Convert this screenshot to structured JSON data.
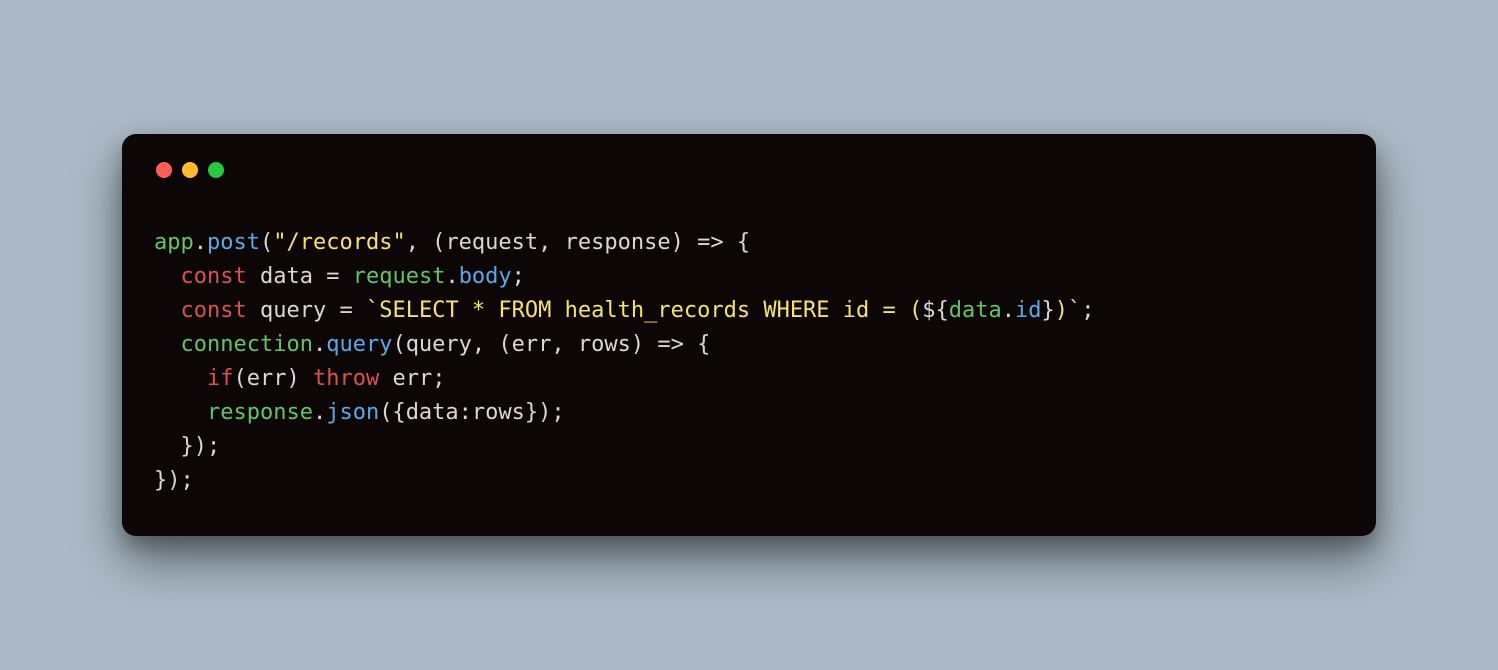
{
  "window": {
    "traffic_lights": [
      "red",
      "yellow",
      "green"
    ]
  },
  "code": {
    "line1": {
      "t1": "app",
      "t2": ".",
      "t3": "post",
      "t4": "(",
      "t5": "\"/records\"",
      "t6": ", (",
      "t7": "request",
      "t8": ", ",
      "t9": "response",
      "t10": ") ",
      "t11": "=>",
      "t12": " {"
    },
    "line2": {
      "indent": "  ",
      "t1": "const",
      "t2": " ",
      "t3": "data",
      "t4": " ",
      "t5": "=",
      "t6": " ",
      "t7": "request",
      "t8": ".",
      "t9": "body",
      "t10": ";"
    },
    "line3": {
      "indent": "  ",
      "t1": "const",
      "t2": " ",
      "t3": "query",
      "t4": " ",
      "t5": "=",
      "t6": " ",
      "t7": "`SELECT * FROM health_records WHERE id = (",
      "t8": "${",
      "t9": "data",
      "t10": ".",
      "t11": "id",
      "t12": "}",
      "t13": ")`",
      "t14": ";"
    },
    "line4": {
      "indent": "  ",
      "t1": "connection",
      "t2": ".",
      "t3": "query",
      "t4": "(",
      "t5": "query",
      "t6": ", (",
      "t7": "err",
      "t8": ", ",
      "t9": "rows",
      "t10": ") ",
      "t11": "=>",
      "t12": " {"
    },
    "line5": {
      "indent": "    ",
      "t1": "if",
      "t2": "(",
      "t3": "err",
      "t4": ") ",
      "t5": "throw",
      "t6": " ",
      "t7": "err",
      "t8": ";"
    },
    "line6": {
      "indent": "    ",
      "t1": "response",
      "t2": ".",
      "t3": "json",
      "t4": "({",
      "t5": "data",
      "t6": ":",
      "t7": "rows",
      "t8": "});"
    },
    "line7": {
      "indent": "  ",
      "t1": "});"
    },
    "line8": {
      "t1": "});"
    }
  }
}
